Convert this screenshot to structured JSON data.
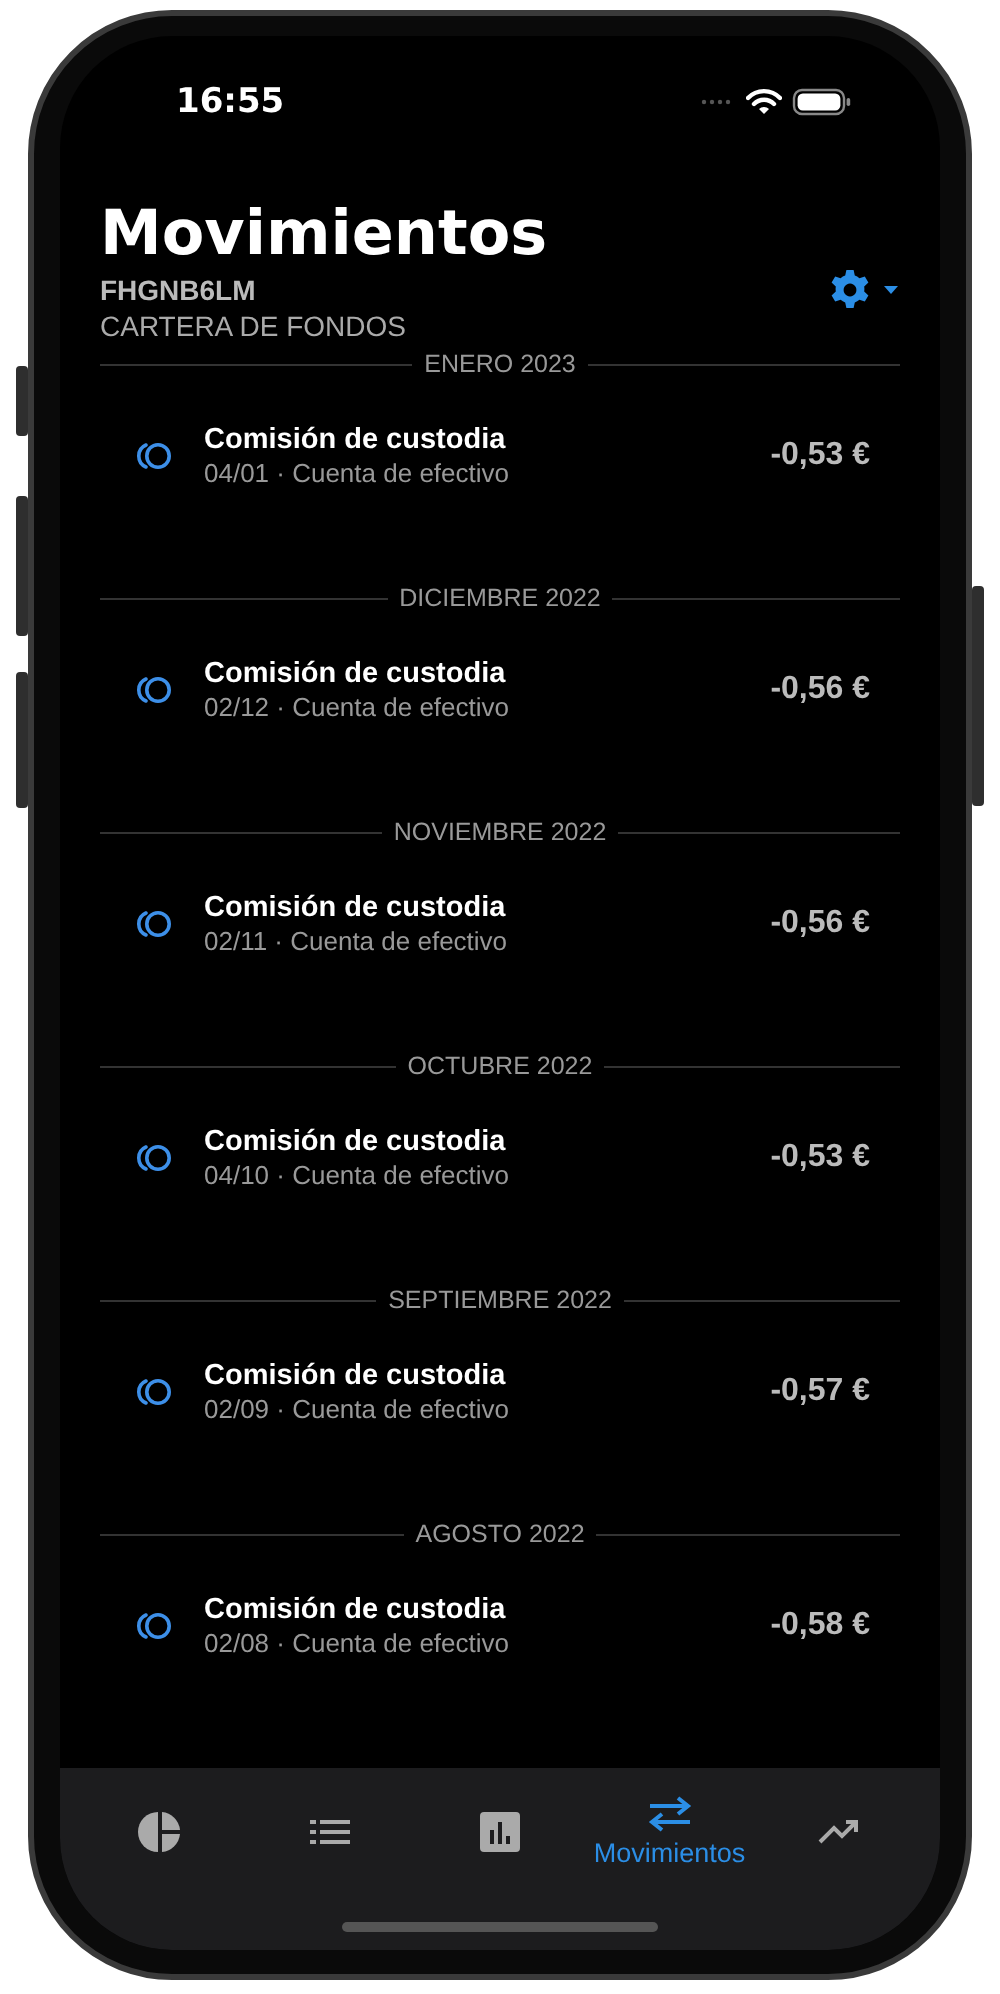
{
  "status_bar": {
    "time": "16:55"
  },
  "header": {
    "title": "Movimientos",
    "account_id": "FHGNB6LM",
    "account_type": "CARTERA DE FONDOS"
  },
  "groups": [
    {
      "month": "ENERO 2023",
      "items": [
        {
          "title": "Comisión de custodia",
          "subtitle": "04/01 · Cuenta de efectivo",
          "amount": "-0,53 €"
        }
      ]
    },
    {
      "month": "DICIEMBRE 2022",
      "items": [
        {
          "title": "Comisión de custodia",
          "subtitle": "02/12 · Cuenta de efectivo",
          "amount": "-0,56 €"
        }
      ]
    },
    {
      "month": "NOVIEMBRE 2022",
      "items": [
        {
          "title": "Comisión de custodia",
          "subtitle": "02/11 · Cuenta de efectivo",
          "amount": "-0,56 €"
        }
      ]
    },
    {
      "month": "OCTUBRE 2022",
      "items": [
        {
          "title": "Comisión de custodia",
          "subtitle": "04/10 · Cuenta de efectivo",
          "amount": "-0,53 €"
        }
      ]
    },
    {
      "month": "SEPTIEMBRE 2022",
      "items": [
        {
          "title": "Comisión de custodia",
          "subtitle": "02/09 · Cuenta de efectivo",
          "amount": "-0,57 €"
        }
      ]
    },
    {
      "month": "AGOSTO 2022",
      "items": [
        {
          "title": "Comisión de custodia",
          "subtitle": "02/08 · Cuenta de efectivo",
          "amount": "-0,58 €"
        }
      ]
    }
  ],
  "tabs": [
    {
      "kind": "pie",
      "selected": false
    },
    {
      "kind": "list",
      "selected": false
    },
    {
      "kind": "bars",
      "selected": false
    },
    {
      "kind": "transfer",
      "label": "Movimientos",
      "selected": true
    },
    {
      "kind": "trend",
      "selected": false
    }
  ]
}
